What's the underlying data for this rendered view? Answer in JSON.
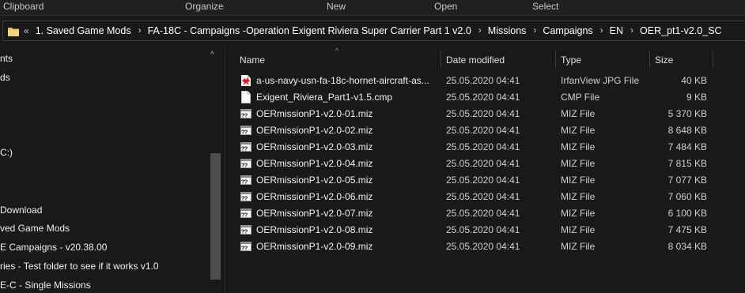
{
  "ribbon": {
    "groups": [
      "Clipboard",
      "Organize",
      "New",
      "Open",
      "Select"
    ]
  },
  "address": {
    "overflow": "«",
    "breadcrumbs": [
      "1. Saved Game Mods",
      "FA-18C - Campaigns -Operation Exigent Riviera Super Carrier Part 1 v2.0",
      "Missions",
      "Campaigns",
      "EN",
      "OER_pt1-v2.0_SC"
    ],
    "separator": "›"
  },
  "nav": {
    "scroll_up": "^",
    "items": [
      "nts",
      "ds",
      "C:)",
      "Download",
      "ved Game Mods",
      "E Campaigns - v20.38.00",
      "ries - Test folder to see if it works v1.0",
      "E-C - Single Missions"
    ]
  },
  "columns": {
    "name": "Name",
    "date": "Date modified",
    "type": "Type",
    "size": "Size",
    "sort_indicator": "^"
  },
  "files": [
    {
      "name": "a-us-navy-usn-fa-18c-hornet-aircraft-as...",
      "date": "25.05.2020 04:41",
      "type": "IrfanView JPG File",
      "size": "40 KB",
      "icon": "irfanview-jpg-icon"
    },
    {
      "name": "Exigent_Riviera_Part1-v1.5.cmp",
      "date": "25.05.2020 04:41",
      "type": "CMP File",
      "size": "9 KB",
      "icon": "blank-file-icon"
    },
    {
      "name": "OERmissionP1-v2.0-01.miz",
      "date": "25.05.2020 04:41",
      "type": "MIZ File",
      "size": "5 370 KB",
      "icon": "miz-file-icon"
    },
    {
      "name": "OERmissionP1-v2.0-02.miz",
      "date": "25.05.2020 04:41",
      "type": "MIZ File",
      "size": "8 648 KB",
      "icon": "miz-file-icon"
    },
    {
      "name": "OERmissionP1-v2.0-03.miz",
      "date": "25.05.2020 04:41",
      "type": "MIZ File",
      "size": "7 484 KB",
      "icon": "miz-file-icon"
    },
    {
      "name": "OERmissionP1-v2.0-04.miz",
      "date": "25.05.2020 04:41",
      "type": "MIZ File",
      "size": "7 815 KB",
      "icon": "miz-file-icon"
    },
    {
      "name": "OERmissionP1-v2.0-05.miz",
      "date": "25.05.2020 04:41",
      "type": "MIZ File",
      "size": "7 077 KB",
      "icon": "miz-file-icon"
    },
    {
      "name": "OERmissionP1-v2.0-06.miz",
      "date": "25.05.2020 04:41",
      "type": "MIZ File",
      "size": "7 060 KB",
      "icon": "miz-file-icon"
    },
    {
      "name": "OERmissionP1-v2.0-07.miz",
      "date": "25.05.2020 04:41",
      "type": "MIZ File",
      "size": "6 100 KB",
      "icon": "miz-file-icon"
    },
    {
      "name": "OERmissionP1-v2.0-08.miz",
      "date": "25.05.2020 04:41",
      "type": "MIZ File",
      "size": "7 475 KB",
      "icon": "miz-file-icon"
    },
    {
      "name": "OERmissionP1-v2.0-09.miz",
      "date": "25.05.2020 04:41",
      "type": "MIZ File",
      "size": "8 034 KB",
      "icon": "miz-file-icon"
    }
  ],
  "colors": {
    "background": "#191919",
    "text": "#ffffff",
    "folder_yellow": "#e8c15a",
    "jpg_red": "#d4202a"
  }
}
